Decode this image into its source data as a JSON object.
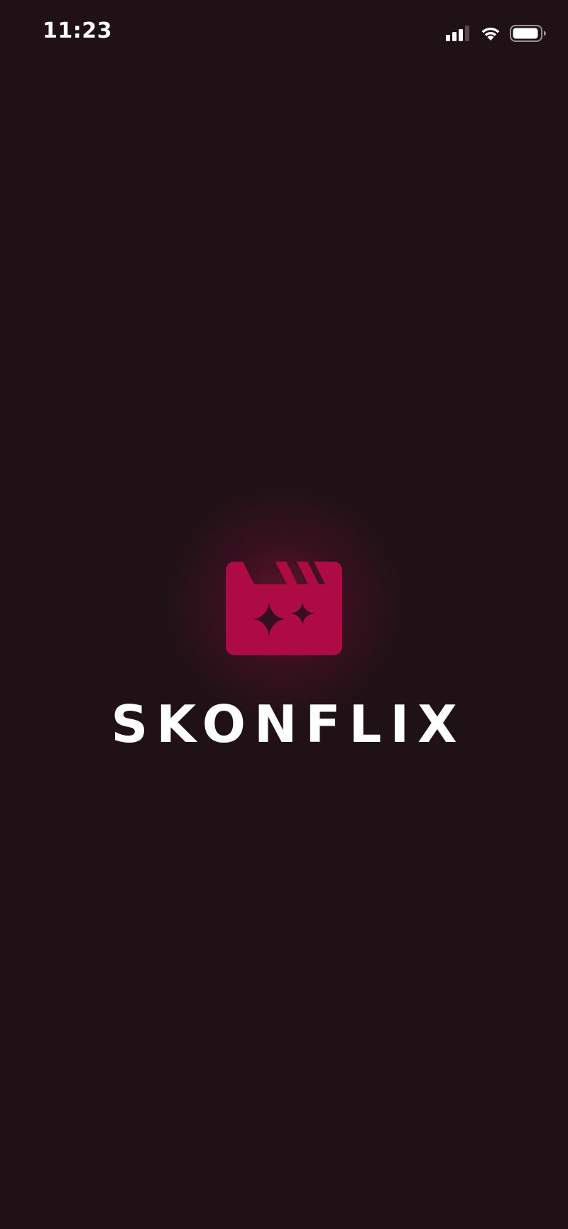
{
  "status_bar": {
    "time": "11:23",
    "signal_icon": "cellular-signal-icon",
    "wifi_icon": "wifi-icon",
    "battery_icon": "battery-icon"
  },
  "splash": {
    "logo_icon": "clapperboard-sparkle-icon",
    "app_name": "SKONFLIX"
  },
  "colors": {
    "background": "#201117",
    "brand": "#AE0B44",
    "text": "#FFFFFF"
  }
}
